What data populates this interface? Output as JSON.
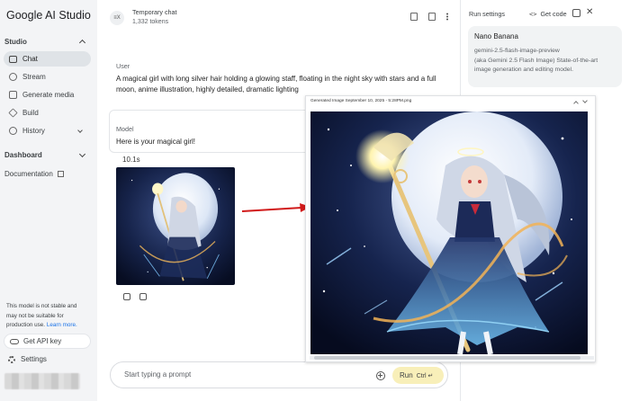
{
  "app": {
    "brand": "Google AI Studio"
  },
  "sidebar": {
    "studio_label": "Studio",
    "items": [
      {
        "label": "Chat",
        "icon": "chat-icon",
        "active": true
      },
      {
        "label": "Stream",
        "icon": "stream-icon"
      },
      {
        "label": "Generate media",
        "icon": "media-icon"
      },
      {
        "label": "Build",
        "icon": "build-icon"
      },
      {
        "label": "History",
        "icon": "history-icon"
      }
    ],
    "dashboard_label": "Dashboard",
    "documentation_label": "Documentation",
    "notice_text": "This model is not stable and may not be suitable for production use.",
    "notice_link": "Learn more.",
    "api_key_label": "Get API key",
    "settings_label": "Settings"
  },
  "chat": {
    "header": {
      "icon_text": "≡X",
      "title": "Temporary chat",
      "tokens": "1,332 tokens"
    },
    "user_label": "User",
    "user_message": "A magical girl with long silver hair holding a glowing staff, floating in the night sky with stars and a full moon, anime illustration, highly detailed, dramatic lighting",
    "model_label": "Model",
    "model_message": "Here is your magical girl!",
    "elapsed": "10.1s",
    "prompt_placeholder": "Start typing a prompt",
    "run_label": "Run",
    "run_shortcut": "Ctrl ↵"
  },
  "run_settings": {
    "title": "Run settings",
    "get_code": "Get code",
    "model_name": "Nano Banana",
    "model_id": "gemini-2.5-flash-image-preview",
    "model_description": "(aka Gemini 2.5 Flash Image) State-of-the-art image generation and editing model."
  },
  "viewer": {
    "title": "Generated Image September 10, 2025 - 5:28PM.png"
  },
  "colors": {
    "sidebar_bg": "#f3f4f6",
    "active_item": "#dfe3e7",
    "run_button": "#f8efb9",
    "link": "#1a73e8",
    "arrow": "#d11a1a",
    "sky": "#0b1633",
    "moon": "#eef3fb"
  }
}
